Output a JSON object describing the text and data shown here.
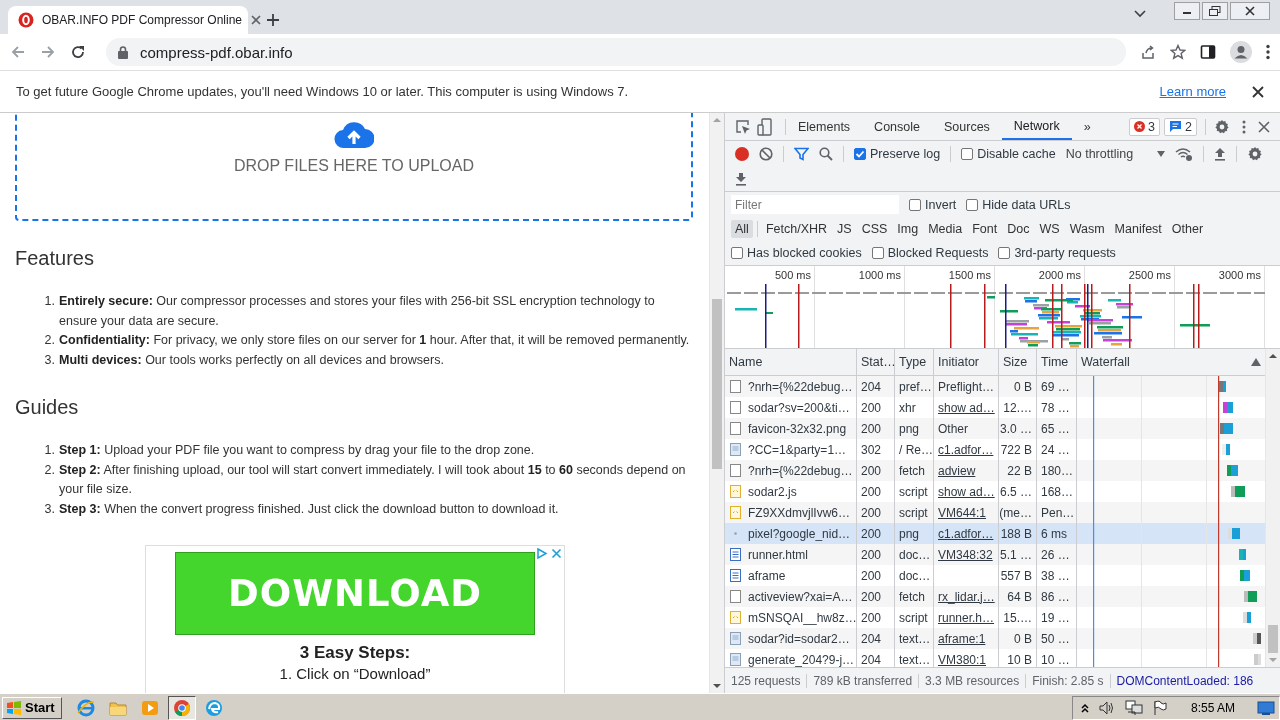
{
  "browser": {
    "tab": {
      "title": "OBAR.INFO PDF Compressor Online"
    },
    "address": "compress-pdf.obar.info"
  },
  "infobar": {
    "message": "To get future Google Chrome updates, you'll need Windows 10 or later. This computer is using Windows 7.",
    "link": "Learn more"
  },
  "page": {
    "dropzone": {
      "label": "DROP FILES HERE TO UPLOAD"
    },
    "sections": [
      {
        "heading": "Features",
        "items": [
          {
            "number": "1.",
            "text": "**Entirely secure:** Our compressor processes and stores your files with 256-bit SSL encryption technology to ensure your data are secure."
          },
          {
            "number": "2.",
            "text": "**Confidentiality:** For privacy, we only store files on our server for **1** hour. After that, it will be removed permanently."
          },
          {
            "number": "3.",
            "text": "**Multi devices:** Our tools works perfectly on all devices and browsers."
          }
        ]
      },
      {
        "heading": "Guides",
        "items": [
          {
            "number": "1.",
            "text": "**Step 1:** Upload your PDF file you want to compress by drag your file to the drop zone."
          },
          {
            "number": "2.",
            "text": "**Step 2:** After finishing upload, our tool will start convert immediately. I will took about **15** to **60** seconds depend on your file size."
          },
          {
            "number": "3.",
            "text": "**Step 3:** When the convert progress finished. Just click the download button to download it."
          }
        ]
      }
    ],
    "ad": {
      "button": "DOWNLOAD",
      "title": "3 Easy Steps:",
      "step": "1. Click on “Download”"
    }
  },
  "devtools": {
    "tabs": [
      {
        "label": "Elements",
        "selected": false
      },
      {
        "label": "Console",
        "selected": false
      },
      {
        "label": "Sources",
        "selected": false
      },
      {
        "label": "Network",
        "selected": true
      }
    ],
    "more": "»",
    "errors": "3",
    "messages": "2",
    "preserve_log": {
      "label": "Preserve log",
      "checked": true
    },
    "disable_cache": {
      "label": "Disable cache",
      "checked": false
    },
    "throttling": "No throttling",
    "filter": {
      "placeholder": "Filter"
    },
    "filter_options": [
      {
        "label": "Invert",
        "checked": false
      },
      {
        "label": "Hide data URLs",
        "checked": false
      }
    ],
    "types": [
      {
        "label": "All",
        "selected": true
      },
      {
        "label": "Fetch/XHR",
        "selected": false
      },
      {
        "label": "JS",
        "selected": false
      },
      {
        "label": "CSS",
        "selected": false
      },
      {
        "label": "Img",
        "selected": false
      },
      {
        "label": "Media",
        "selected": false
      },
      {
        "label": "Font",
        "selected": false
      },
      {
        "label": "Doc",
        "selected": false
      },
      {
        "label": "WS",
        "selected": false
      },
      {
        "label": "Wasm",
        "selected": false
      },
      {
        "label": "Manifest",
        "selected": false
      },
      {
        "label": "Other",
        "selected": false
      }
    ],
    "blocked_options": [
      {
        "label": "Has blocked cookies",
        "checked": false
      },
      {
        "label": "Blocked Requests",
        "checked": false
      },
      {
        "label": "3rd-party requests",
        "checked": false
      }
    ],
    "overview": {
      "ticks": [
        "500 ms",
        "1000 ms",
        "1500 ms",
        "2000 ms",
        "2500 ms",
        "3000 ms"
      ]
    },
    "columns": [
      "Name",
      "Stat…",
      "Type",
      "Initiator",
      "Size",
      "Time",
      "Waterfall"
    ],
    "rows": [
      {
        "kind": "plain",
        "name": "?nrh={%22debug…",
        "status": "204",
        "type": "pref…",
        "initiator": "Preflight…",
        "initiator_link": false,
        "size": "0 B",
        "time": "69 …",
        "highlighted": false
      },
      {
        "kind": "plain",
        "name": "sodar?sv=200&ti…",
        "status": "200",
        "type": "xhr",
        "initiator": "show ad…",
        "initiator_link": true,
        "size": "12.…",
        "time": "78 …",
        "highlighted": false
      },
      {
        "kind": "plain",
        "name": "favicon-32x32.png",
        "status": "200",
        "type": "png",
        "initiator": "Other",
        "initiator_link": false,
        "size": "3.0 …",
        "time": "65 …",
        "highlighted": false
      },
      {
        "kind": "img",
        "name": "?CC=1&party=1…",
        "status": "302",
        "type": "/ Re…",
        "initiator": "c1.adfor…",
        "initiator_link": true,
        "size": "722 B",
        "time": "24 …",
        "highlighted": false
      },
      {
        "kind": "plain",
        "name": "?nrh={%22debug…",
        "status": "200",
        "type": "fetch",
        "initiator": "adview",
        "initiator_link": true,
        "size": "22 B",
        "time": "180…",
        "highlighted": false
      },
      {
        "kind": "js",
        "name": "sodar2.js",
        "status": "200",
        "type": "script",
        "initiator": "show ad…",
        "initiator_link": true,
        "size": "6.5 …",
        "time": "168…",
        "highlighted": false
      },
      {
        "kind": "js",
        "name": "FZ9XXdmvjlIvw6…",
        "status": "200",
        "type": "script",
        "initiator": "VM644:1",
        "initiator_link": true,
        "size": "(me…",
        "time": "Pen…",
        "highlighted": false
      },
      {
        "kind": "pixel",
        "name": "pixel?google_nid…",
        "status": "200",
        "type": "png",
        "initiator": "c1.adfor…",
        "initiator_link": true,
        "size": "188 B",
        "time": "6 ms",
        "highlighted": true
      },
      {
        "kind": "doc",
        "name": "runner.html",
        "status": "200",
        "type": "doc…",
        "initiator": "VM348:32",
        "initiator_link": true,
        "size": "5.1 …",
        "time": "26 …",
        "highlighted": false
      },
      {
        "kind": "doc",
        "name": "aframe",
        "status": "200",
        "type": "doc…",
        "size": "557 B",
        "time": "38 …",
        "highlighted": false
      },
      {
        "kind": "plain",
        "name": "activeview?xai=A…",
        "status": "200",
        "type": "fetch",
        "initiator": "rx_lidar.j…",
        "initiator_link": true,
        "size": "64 B",
        "time": "86 …",
        "highlighted": false
      },
      {
        "kind": "js",
        "name": "mSNSQAI__hw8z…",
        "status": "200",
        "type": "script",
        "initiator": "runner.h…",
        "initiator_link": true,
        "size": "15.…",
        "time": "19 …",
        "highlighted": false
      },
      {
        "kind": "img",
        "name": "sodar?id=sodar2…",
        "status": "204",
        "type": "text…",
        "initiator": "aframe:1",
        "initiator_link": true,
        "size": "0 B",
        "time": "50 …",
        "highlighted": false
      },
      {
        "kind": "img",
        "name": "generate_204?9-j…",
        "status": "204",
        "type": "text…",
        "initiator": "VM380:1",
        "initiator_link": true,
        "size": "10 B",
        "time": "10 …",
        "highlighted": false
      }
    ],
    "summary": [
      {
        "text": "125 requests",
        "kind": "stat"
      },
      {
        "text": "789 kB transferred",
        "kind": "stat"
      },
      {
        "text": "3.3 MB resources",
        "kind": "stat"
      },
      {
        "text": "Finish: 2.85 s",
        "kind": "stat"
      },
      {
        "text": "DOMContentLoaded: 186",
        "kind": "event"
      }
    ]
  },
  "taskbar": {
    "start": "Start",
    "apps": [
      {
        "kind": "ie",
        "active": false
      },
      {
        "kind": "folder",
        "active": false
      },
      {
        "kind": "media",
        "active": false
      },
      {
        "kind": "chrome",
        "active": true
      },
      {
        "kind": "edge",
        "active": false
      }
    ],
    "clock": "8:55 AM"
  }
}
